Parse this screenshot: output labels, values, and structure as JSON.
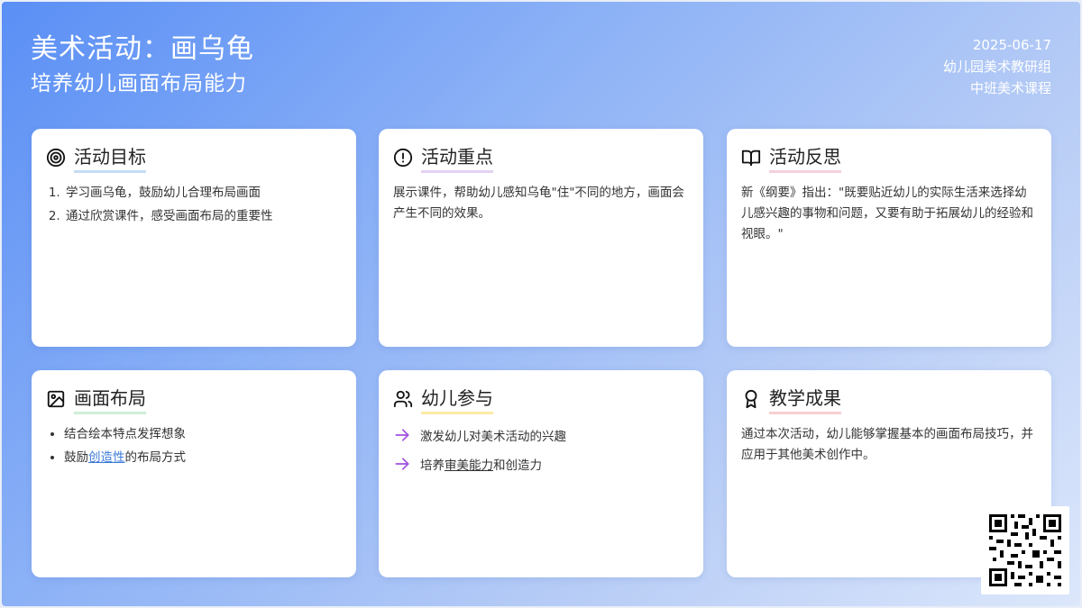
{
  "header": {
    "title": "美术活动：画乌龟",
    "subtitle": "培养幼儿画面布局能力",
    "date": "2025-06-17",
    "org": "幼儿园美术教研组",
    "course": "中班美术课程"
  },
  "cards": {
    "goals": {
      "title": "活动目标",
      "icon": "target-icon",
      "items": [
        "学习画乌龟，鼓励幼儿合理布局画面",
        "通过欣赏课件，感受画面布局的重要性"
      ]
    },
    "focus": {
      "title": "活动重点",
      "icon": "alert-circle-icon",
      "text": "展示课件，帮助幼儿感知乌龟\"住\"不同的地方，画面会产生不同的效果。"
    },
    "reflection": {
      "title": "活动反思",
      "icon": "open-book-icon",
      "text": "新《纲要》指出：\"既要贴近幼儿的实际生活来选择幼儿感兴趣的事物和问题，又要有助于拓展幼儿的经验和视眼。\""
    },
    "layout": {
      "title": "画面布局",
      "icon": "image-icon",
      "item1": "结合绘本特点发挥想象",
      "item2_pre": "鼓励",
      "item2_link": "创造性",
      "item2_post": "的布局方式"
    },
    "participation": {
      "title": "幼儿参与",
      "icon": "users-icon",
      "item1": "激发幼儿对美术活动的兴趣",
      "item2_pre": "培养",
      "item2_ul": "审美能力",
      "item2_post": "和创造力"
    },
    "outcome": {
      "title": "教学成果",
      "icon": "award-icon",
      "text": "通过本次活动，幼儿能够掌握基本的画面布局技巧，并应用于其他美术创作中。"
    }
  },
  "qr": {
    "icon": "qr-code-icon"
  },
  "colors": {
    "accent_blue": "#5a8ff5",
    "arrow_purple": "#a14fe0",
    "link": "#3a78d6"
  }
}
